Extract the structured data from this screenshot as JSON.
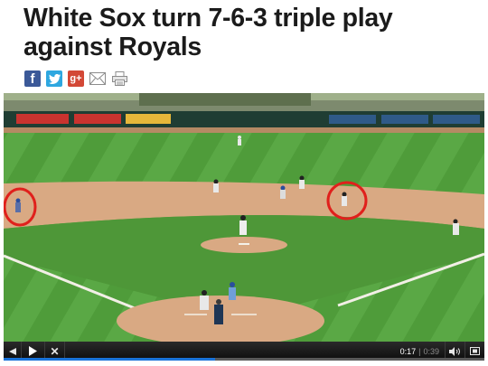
{
  "article": {
    "headline": "White Sox turn 7-6-3 triple play against Royals"
  },
  "share": {
    "items": [
      {
        "name": "facebook",
        "glyph": "f",
        "icon": "facebook-icon"
      },
      {
        "name": "twitter",
        "glyph": "t",
        "icon": "twitter-icon"
      },
      {
        "name": "google-plus",
        "glyph": "g+",
        "icon": "google-plus-icon"
      },
      {
        "name": "email",
        "icon": "mail-icon"
      },
      {
        "name": "print",
        "icon": "printer-icon"
      }
    ]
  },
  "video": {
    "current_time": "0:17",
    "separator": "|",
    "duration": "0:39",
    "progress_fraction": 0.44,
    "icons": [
      "rewind-icon",
      "play-icon",
      "close-icon",
      "volume-icon",
      "fullscreen-icon"
    ]
  },
  "colors": {
    "facebook": "#3b5998",
    "twitter": "#2ea7e0",
    "google_plus": "#d34836",
    "progress": "#1a73d9",
    "grass": "#4f9a3c",
    "dirt": "#d9a983",
    "highlight_circle": "#e0201c"
  }
}
